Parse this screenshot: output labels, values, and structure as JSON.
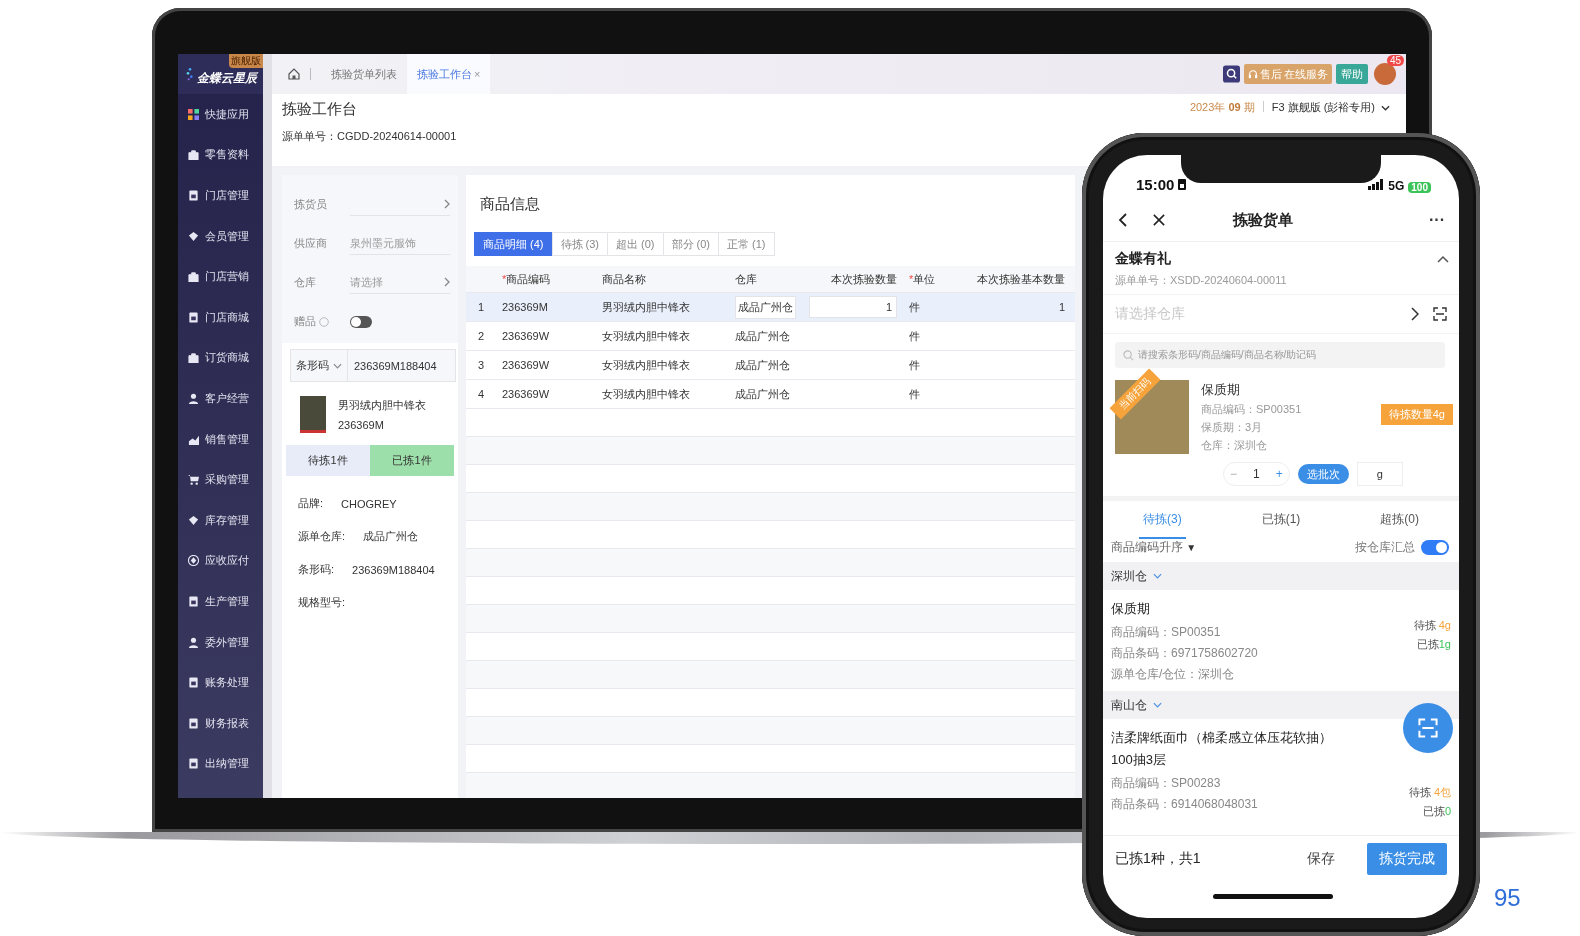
{
  "laptop": {
    "logo": {
      "name": "金蝶云星辰",
      "badge": "旗舰版"
    },
    "sidebar": [
      {
        "label": "快捷应用"
      },
      {
        "label": "零售资料"
      },
      {
        "label": "门店管理"
      },
      {
        "label": "会员管理"
      },
      {
        "label": "门店营销"
      },
      {
        "label": "门店商城"
      },
      {
        "label": "订货商城"
      },
      {
        "label": "客户经营"
      },
      {
        "label": "销售管理"
      },
      {
        "label": "采购管理"
      },
      {
        "label": "库存管理"
      },
      {
        "label": "应收应付"
      },
      {
        "label": "生产管理"
      },
      {
        "label": "委外管理"
      },
      {
        "label": "账务处理"
      },
      {
        "label": "财务报表"
      },
      {
        "label": "出纳管理"
      }
    ],
    "tabs": [
      {
        "label": "拣验货单列表",
        "selected": false
      },
      {
        "label": "拣验工作台",
        "selected": true,
        "close": "×"
      }
    ],
    "toolbar": {
      "service": "售后",
      "service_sub": "在线服务",
      "help": "帮助",
      "badge": "45",
      "period_year": "2023年",
      "period_num": "09",
      "period_unit": "期",
      "edition": "F3 旗舰版 (彭裕专用)"
    },
    "page": {
      "title": "拣验工作台",
      "source": "源单单号：CGDD-20240614-00001"
    },
    "form": [
      {
        "label": "拣货员",
        "kind": "select"
      },
      {
        "label": "供应商",
        "kind": "text",
        "value": "泉州墨元服饰"
      },
      {
        "label": "仓库",
        "kind": "select",
        "placeholder": "请选择"
      },
      {
        "label": "赠品",
        "kind": "toggle",
        "on": false
      }
    ],
    "scan": {
      "mode": "条形码",
      "value": "236369M188404"
    },
    "product": {
      "name": "男羽绒内胆中锋衣",
      "code": "236369M"
    },
    "counts": [
      {
        "label": "待拣1件",
        "selected": false
      },
      {
        "label": "已拣1件",
        "selected": true
      }
    ],
    "details": [
      {
        "label": "品牌:",
        "value": "CHOGREY"
      },
      {
        "label": "源单仓库:",
        "value": "成品广州仓"
      },
      {
        "label": "条形码:",
        "value": "236369M188404"
      },
      {
        "label": "规格型号:"
      }
    ],
    "table": {
      "title": "商品信息",
      "filters": [
        {
          "label": "商品明细 (4)",
          "selected": true
        },
        {
          "label": "待拣 (3)",
          "selected": false
        },
        {
          "label": "超出 (0)",
          "selected": false
        },
        {
          "label": "部分 (0)",
          "selected": false
        },
        {
          "label": "正常 (1)",
          "selected": false
        }
      ],
      "columns": [
        {
          "mark": "*",
          "label": "商品编码"
        },
        {
          "label": "商品名称"
        },
        {
          "label": "仓库"
        },
        {
          "label": "本次拣验数量"
        },
        {
          "mark": "*",
          "label": "单位"
        },
        {
          "label": "本次拣验基本数量"
        }
      ],
      "rows": [
        {
          "index": "1",
          "code": "236369M",
          "name": "男羽绒内胆中锋衣",
          "warehouse": "成品广州仓",
          "qty": "1",
          "unit": "件",
          "base_qty": "1",
          "selected": true
        },
        {
          "index": "2",
          "code": "236369W",
          "name": "女羽绒内胆中锋衣",
          "warehouse": "成品广州仓",
          "unit": "件",
          "selected": false
        },
        {
          "index": "3",
          "code": "236369W",
          "name": "女羽绒内胆中锋衣",
          "warehouse": "成品广州仓",
          "unit": "件",
          "selected": false
        },
        {
          "index": "4",
          "code": "236369W",
          "name": "女羽绒内胆中锋衣",
          "warehouse": "成品广州仓",
          "unit": "件",
          "selected": false
        }
      ]
    }
  },
  "phone": {
    "status": {
      "time": "15:00",
      "network": "5G",
      "battery": "100"
    },
    "title": "拣验货单",
    "more": "···",
    "order": {
      "name": "金蝶有礼",
      "source": "源单单号：XSDD-20240604-00011"
    },
    "warehouse": {
      "placeholder": "请选择仓库"
    },
    "search": {
      "placeholder": "请搜索条形码/商品编码/商品名称/助记码"
    },
    "current": {
      "ribbon": "当前扫码",
      "name": "保质期",
      "lines": [
        "商品编码：SP00351",
        "保质期：3月",
        "仓库：深圳仓"
      ],
      "badge": "待拣数量4g",
      "minus": "−",
      "qty": "1",
      "plus": "+",
      "batch": "选批次",
      "unit": "g"
    },
    "tabs": [
      {
        "label": "待拣(3)",
        "selected": true
      },
      {
        "label": "已拣(1)",
        "selected": false
      },
      {
        "label": "超拣(0)",
        "selected": false
      }
    ],
    "sort": "商品编码升序",
    "sort_caret": "▼",
    "group_toggle": {
      "label": "按仓库汇总",
      "on": true
    },
    "groups": [
      {
        "name": "深圳仓",
        "items": [
          {
            "name": "保质期",
            "lines": [
              "商品编码：SP00351",
              "商品条码：6971758602720",
              "源单仓库/仓位：深圳仓"
            ],
            "pending_label": "待拣",
            "pending": "4g",
            "picked_label": "已拣",
            "picked": "1g"
          }
        ]
      },
      {
        "name": "南山仓",
        "items": [
          {
            "name": "洁柔牌纸面巾（棉柔感立体压花软抽）100抽3层",
            "lines": [
              "商品编码：SP00283",
              "商品条码：6914068048031"
            ],
            "pending_label": "待拣",
            "pending": "4包",
            "picked_label": "已拣",
            "picked": "0"
          }
        ]
      }
    ],
    "summary": "已拣1种，共1",
    "save": "保存",
    "finish": "拣货完成"
  },
  "page_number": "95"
}
